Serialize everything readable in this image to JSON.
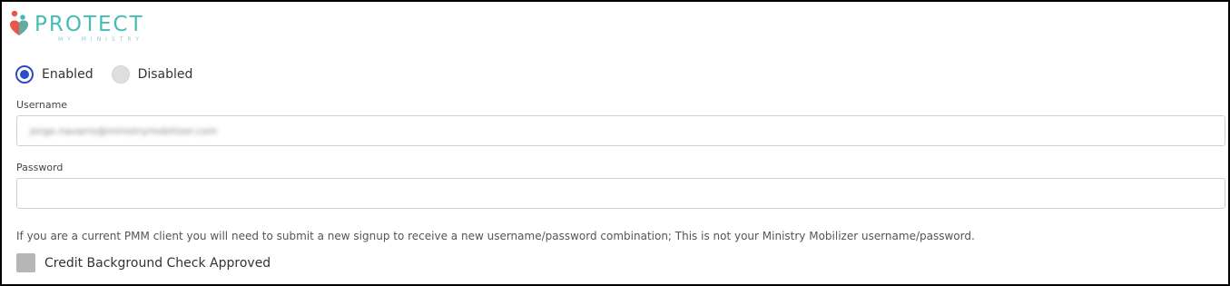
{
  "logo": {
    "title": "PROTECT",
    "subtitle": "MY MINISTRY",
    "colors": {
      "primary": "#45bcb4",
      "accent": "#e8574a"
    }
  },
  "status": {
    "options": [
      {
        "label": "Enabled",
        "selected": true
      },
      {
        "label": "Disabled",
        "selected": false
      }
    ]
  },
  "username": {
    "label": "Username",
    "value": "jorge.navarro@ministrymobilizer.com"
  },
  "password": {
    "label": "Password",
    "value": ""
  },
  "help_text": "If you are a current PMM client you will need to submit a new signup to receive a new username/password combination; This is not your Ministry Mobilizer username/password.",
  "credit_check": {
    "label": "Credit Background Check Approved",
    "checked": false
  },
  "colors": {
    "radio_selected": "#2d4cc8",
    "border": "#000000"
  }
}
